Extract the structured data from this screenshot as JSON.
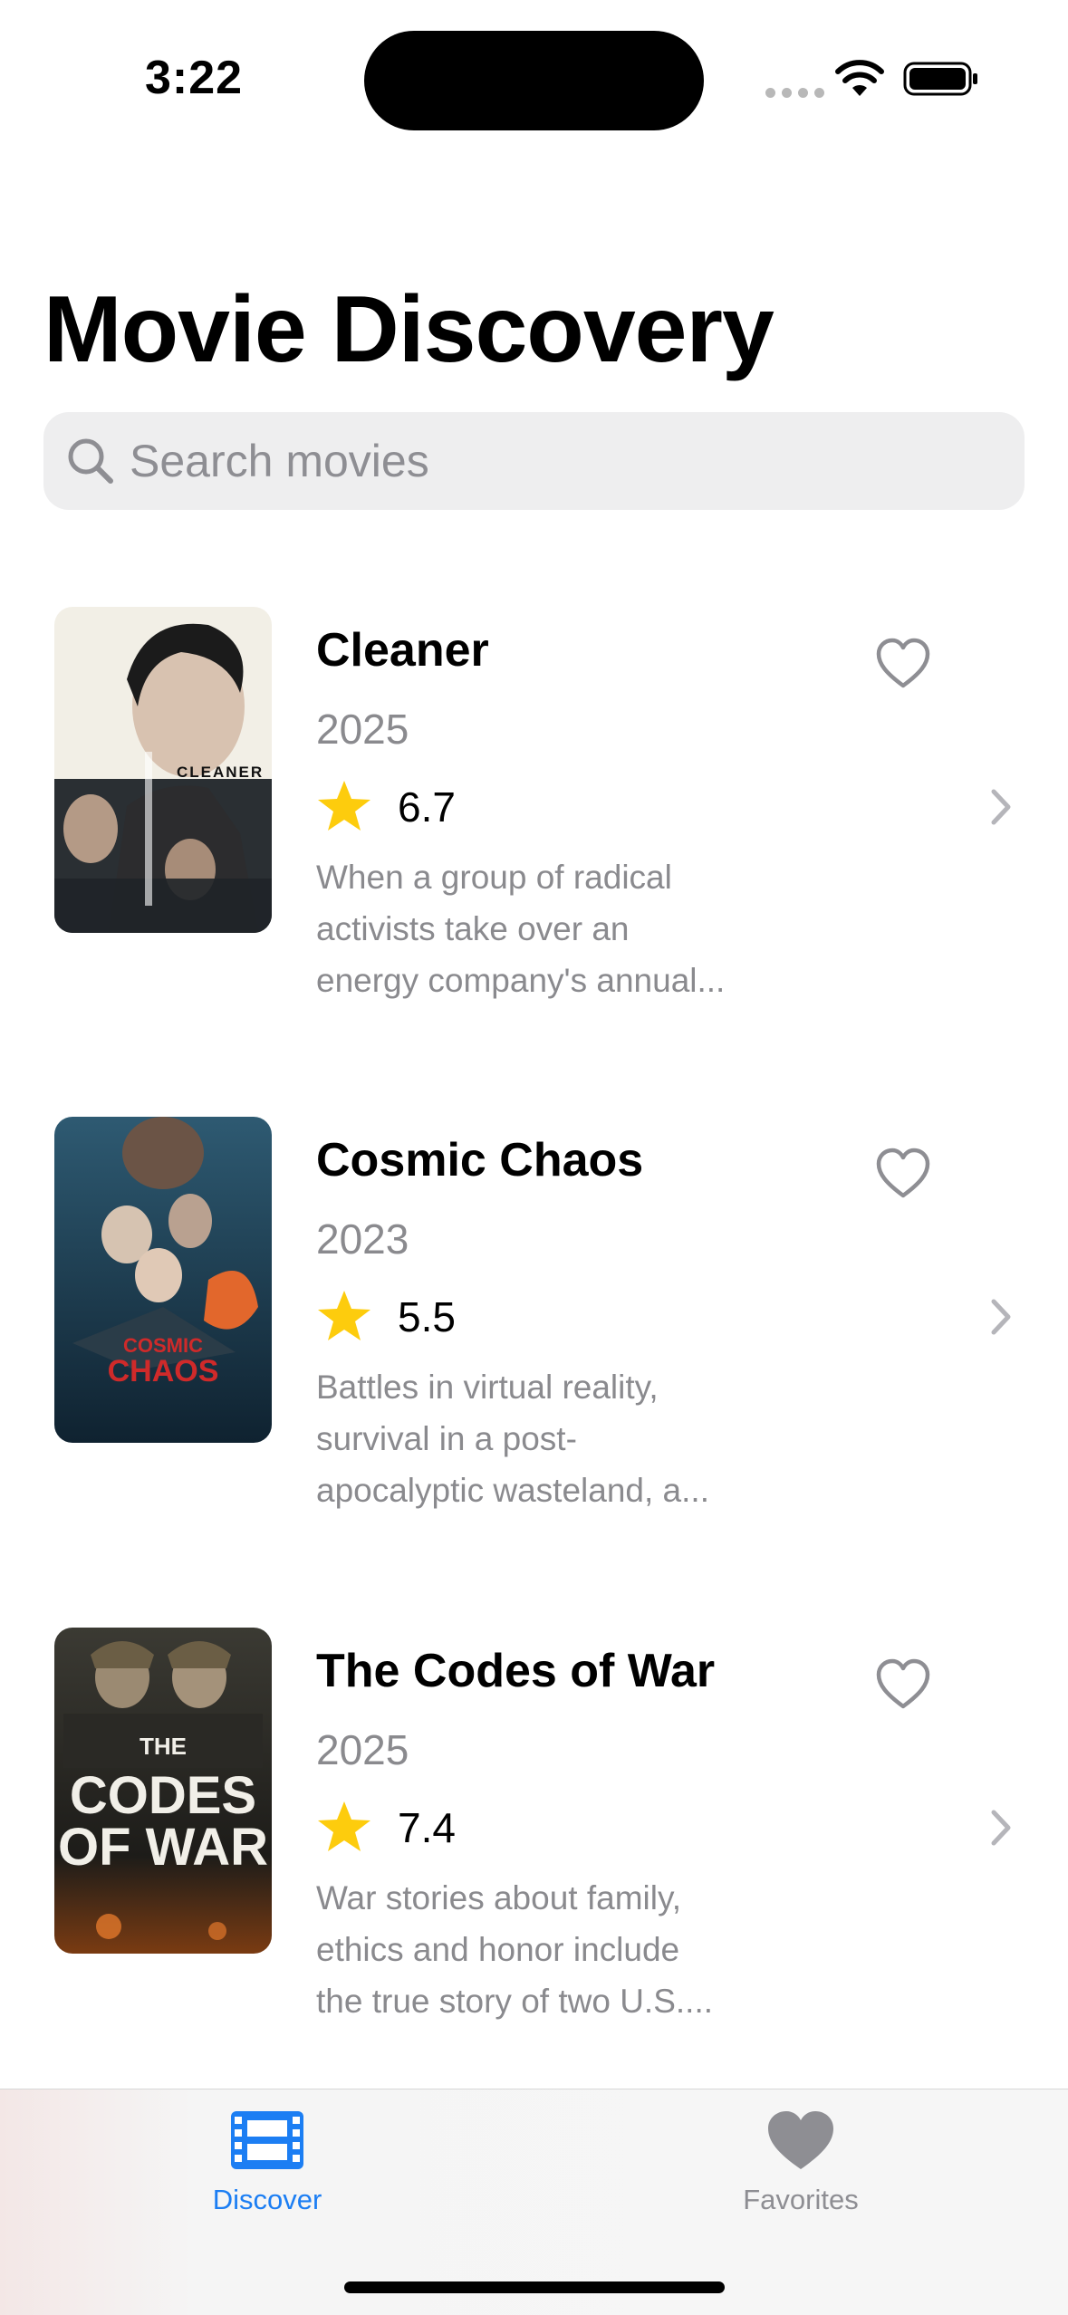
{
  "status_bar": {
    "time": "3:22"
  },
  "header": {
    "title": "Movie Discovery"
  },
  "search": {
    "placeholder": "Search movies",
    "value": ""
  },
  "movies": [
    {
      "title": "Cleaner",
      "year": "2025",
      "rating": "6.7",
      "overview_lines": [
        "When a group of radical",
        "activists take over an",
        "energy company's annual..."
      ],
      "favorited": false,
      "poster_icon": "cleaner-poster"
    },
    {
      "title": "Cosmic Chaos",
      "year": "2023",
      "rating": "5.5",
      "overview_lines": [
        "Battles in virtual reality,",
        "survival in a post-",
        "apocalyptic wasteland, a..."
      ],
      "favorited": false,
      "poster_icon": "cosmic-chaos-poster"
    },
    {
      "title": "The Codes of War",
      "year": "2025",
      "rating": "7.4",
      "overview_lines": [
        "War stories about family,",
        "ethics and honor include",
        "the true story of two U.S...."
      ],
      "favorited": false,
      "poster_icon": "codes-of-war-poster"
    }
  ],
  "tab_bar": {
    "tabs": [
      {
        "label": "Discover",
        "icon": "film-icon",
        "selected": true
      },
      {
        "label": "Favorites",
        "icon": "heart-icon",
        "selected": false
      }
    ]
  },
  "colors": {
    "accent": "#1c7ef3",
    "star": "#fdcc0d",
    "secondary_text": "#8a8a8e"
  }
}
